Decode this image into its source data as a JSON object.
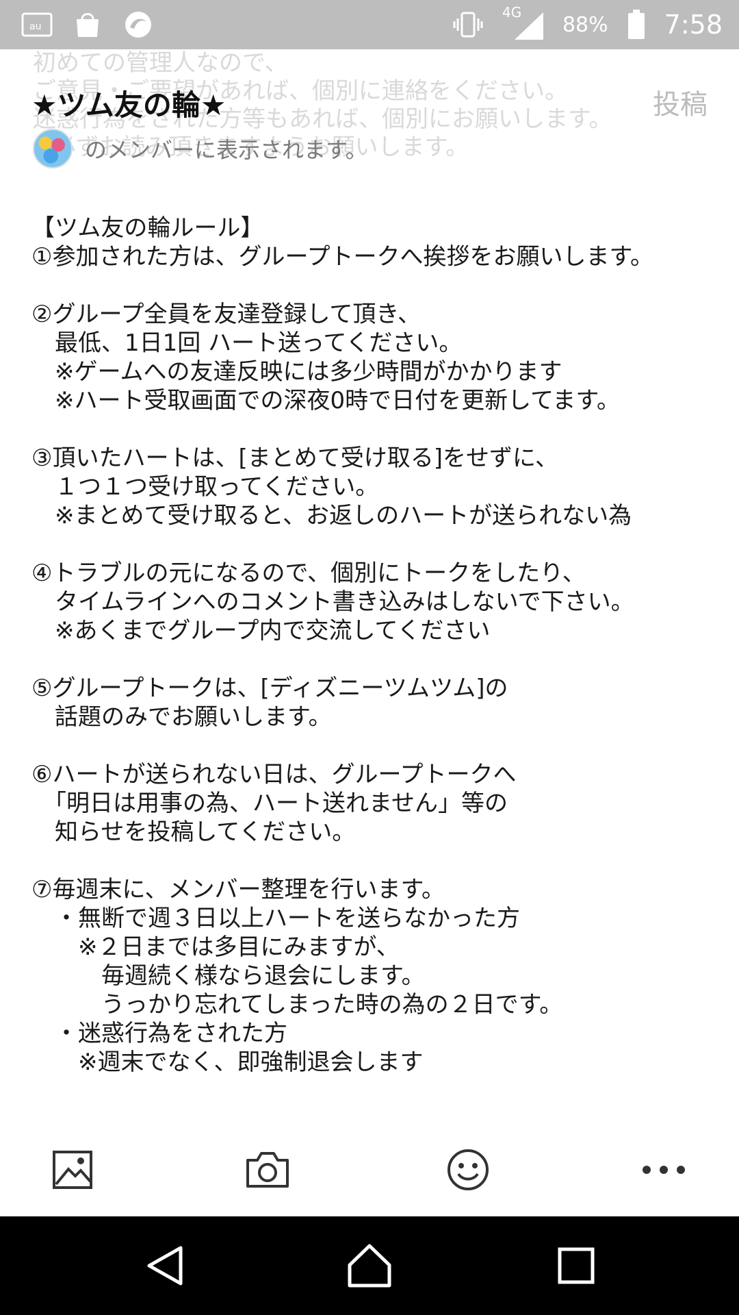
{
  "status_bar": {
    "carrier_icon": "au-icon",
    "market_icon": "market-icon",
    "app_icon": "swirl-app-icon",
    "vibrate_icon": "vibrate-icon",
    "network_label": "4G",
    "battery_percent": "88%",
    "time": "7:58"
  },
  "header": {
    "background_text": "初めての管理人なので、\nご意見・ご要望があれば、個別に連絡をください。\n迷惑行為をされた方等もあれば、個別にお願いします。\n※必ずお読み頂きますようお願いします。",
    "title": "★ツム友の輪★",
    "post_label": "投稿",
    "visibility_text": "のメンバーに表示されます。"
  },
  "post": {
    "body": "【ツム友の輪ルール】\n①参加された方は、グループトークへ挨拶をお願いします。\n\n②グループ全員を友達登録して頂き、\n　最低、1日1回 ハート送ってください。\n　※ゲームへの友達反映には多少時間がかかります\n　※ハート受取画面での深夜0時で日付を更新してます。\n\n③頂いたハートは、[まとめて受け取る]をせずに、\n　１つ１つ受け取ってください。\n　※まとめて受け取ると、お返しのハートが送られない為\n\n④トラブルの元になるので、個別にトークをしたり、\n　タイムラインへのコメント書き込みはしないで下さい。\n　※あくまでグループ内で交流してください\n\n⑤グループトークは、[ディズニーツムツム]の\n　話題のみでお願いします。\n\n⑥ハートが送られない日は、グループトークへ\n　「明日は用事の為、ハート送れません」等の\n　知らせを投稿してください。\n\n⑦毎週末に、メンバー整理を行います。\n　・無断で週３日以上ハートを送らなかった方\n　　※２日までは多目にみますが、\n　　　毎週続く様なら退会にします。\n　　　うっかり忘れてしまった時の為の２日です。\n　・迷惑行為をされた方\n　　※週末でなく、即強制退会します"
  },
  "toolbar": {
    "items": [
      "image-icon",
      "camera-icon",
      "smiley-icon",
      "more-icon"
    ]
  },
  "nav": {
    "items": [
      "back-icon",
      "home-icon",
      "recents-icon"
    ]
  },
  "colors": {
    "status_bar_bg": "#bdbdbd",
    "nav_bar_bg": "#000000",
    "text": "#1a1a1a",
    "muted": "#7a7a7a",
    "ghost": "#d9d9d9"
  }
}
